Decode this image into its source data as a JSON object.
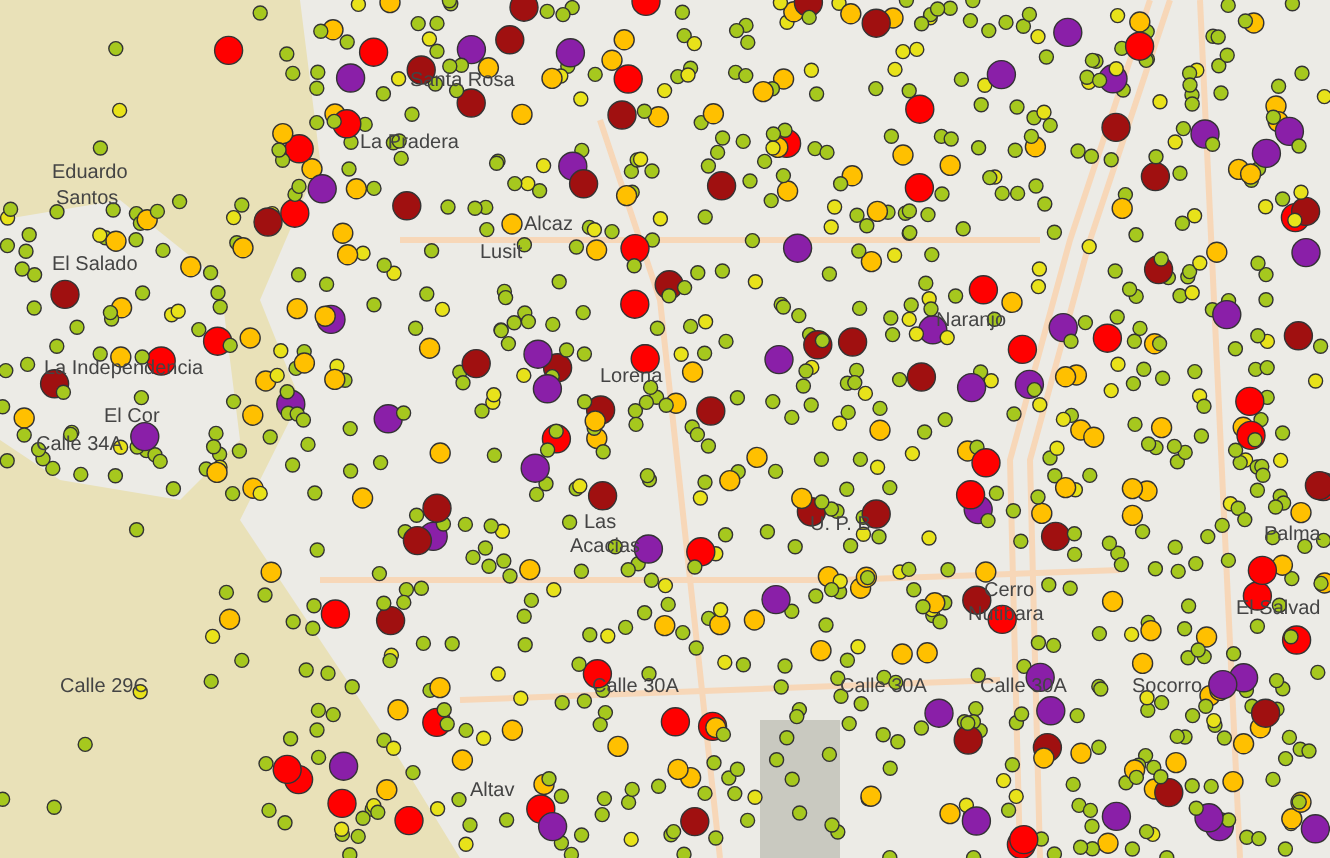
{
  "map": {
    "labels": [
      {
        "text": "Santa Rosa"
      },
      {
        "text": "La Pradera"
      },
      {
        "text": "Eduardo"
      },
      {
        "text": "Santos"
      },
      {
        "text": "Alcaz"
      },
      {
        "text": "Lusit"
      },
      {
        "text": "El Salado"
      },
      {
        "text": "Naranjo"
      },
      {
        "text": "La Independencia"
      },
      {
        "text": "Lorena"
      },
      {
        "text": "El Cor"
      },
      {
        "text": "Calle 34A"
      },
      {
        "text": "Las"
      },
      {
        "text": "U. P. B"
      },
      {
        "text": "Palma"
      },
      {
        "text": "Acacias"
      },
      {
        "text": "Cerro"
      },
      {
        "text": "El Salvad"
      },
      {
        "text": "Nutibara"
      },
      {
        "text": "Calle 29C"
      },
      {
        "text": "Calle 30A"
      },
      {
        "text": "Calle 30A"
      },
      {
        "text": "Calle 30A"
      },
      {
        "text": "Socorro"
      },
      {
        "text": "Altav"
      }
    ]
  }
}
